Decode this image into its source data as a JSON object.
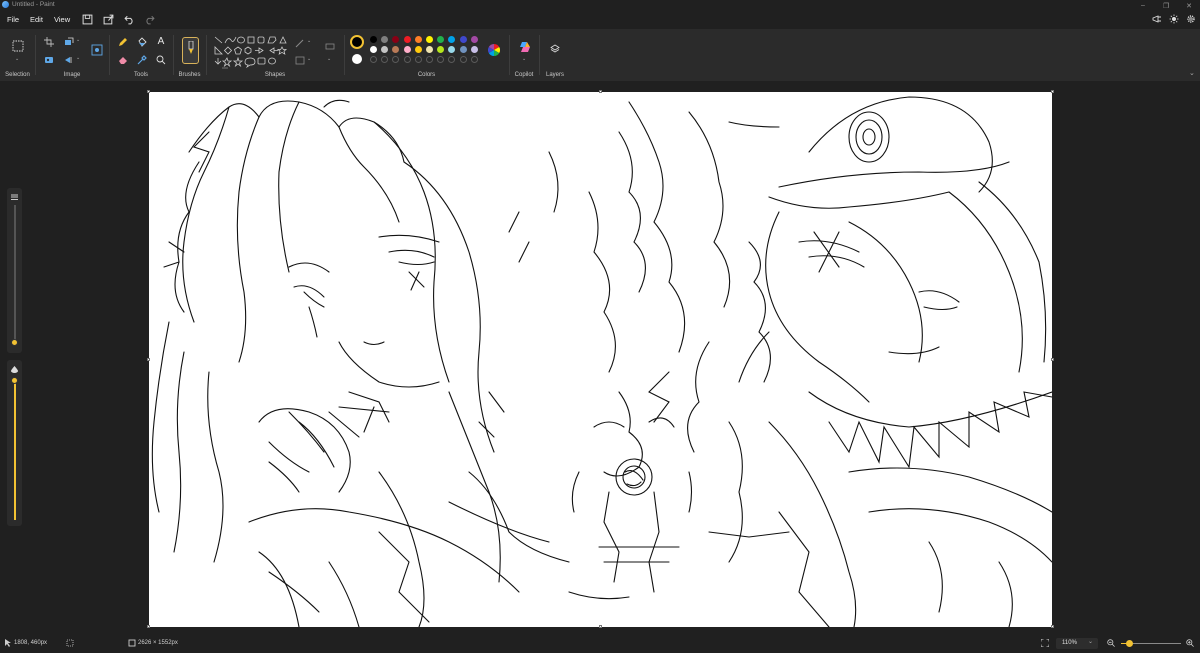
{
  "window": {
    "title": "Untitled - Paint"
  },
  "menu": {
    "file": "File",
    "edit": "Edit",
    "view": "View"
  },
  "ribbon": {
    "groups": {
      "selection": "Selection",
      "image": "Image",
      "tools": "Tools",
      "brushes": "Brushes",
      "shapes": "Shapes",
      "colors": "Colors",
      "copilot": "Copilot",
      "layers": "Layers"
    },
    "text_tool_glyph": "A",
    "primary_color": "#000000",
    "secondary_color": "#ffffff",
    "palette_row1": [
      "#000000",
      "#7f7f7f",
      "#880015",
      "#ed1c24",
      "#ff7f27",
      "#fff200",
      "#22b14c",
      "#00a2e8",
      "#3f48cc",
      "#a349a4"
    ],
    "palette_row2": [
      "#ffffff",
      "#c3c3c3",
      "#b97a57",
      "#ffaec9",
      "#ffc90e",
      "#efe4b0",
      "#b5e61d",
      "#99d9ea",
      "#7092be",
      "#c8bfe7"
    ]
  },
  "status": {
    "cursor_position": "1808, 460px",
    "canvas_size": "2626 × 1552px",
    "zoom": "110%"
  },
  "accent": "#f2c233"
}
